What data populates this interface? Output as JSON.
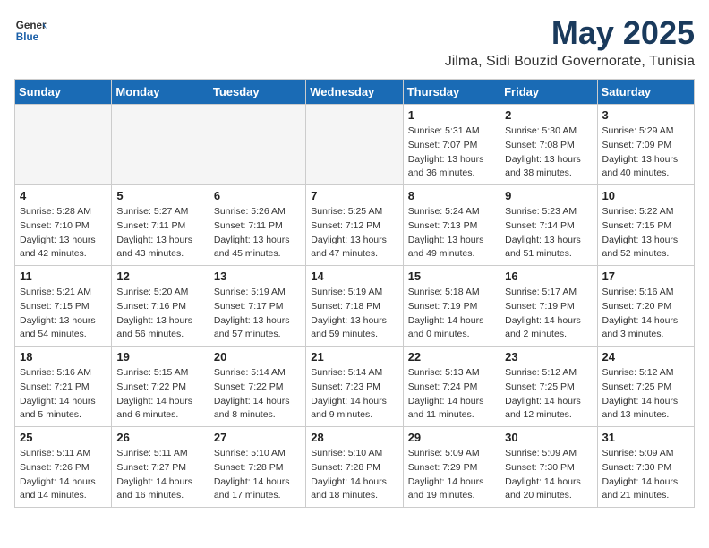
{
  "header": {
    "logo_general": "General",
    "logo_blue": "Blue",
    "month_year": "May 2025",
    "location": "Jilma, Sidi Bouzid Governorate, Tunisia"
  },
  "days_of_week": [
    "Sunday",
    "Monday",
    "Tuesday",
    "Wednesday",
    "Thursday",
    "Friday",
    "Saturday"
  ],
  "weeks": [
    [
      {
        "day": "",
        "info": ""
      },
      {
        "day": "",
        "info": ""
      },
      {
        "day": "",
        "info": ""
      },
      {
        "day": "",
        "info": ""
      },
      {
        "day": "1",
        "info": "Sunrise: 5:31 AM\nSunset: 7:07 PM\nDaylight: 13 hours\nand 36 minutes."
      },
      {
        "day": "2",
        "info": "Sunrise: 5:30 AM\nSunset: 7:08 PM\nDaylight: 13 hours\nand 38 minutes."
      },
      {
        "day": "3",
        "info": "Sunrise: 5:29 AM\nSunset: 7:09 PM\nDaylight: 13 hours\nand 40 minutes."
      }
    ],
    [
      {
        "day": "4",
        "info": "Sunrise: 5:28 AM\nSunset: 7:10 PM\nDaylight: 13 hours\nand 42 minutes."
      },
      {
        "day": "5",
        "info": "Sunrise: 5:27 AM\nSunset: 7:11 PM\nDaylight: 13 hours\nand 43 minutes."
      },
      {
        "day": "6",
        "info": "Sunrise: 5:26 AM\nSunset: 7:11 PM\nDaylight: 13 hours\nand 45 minutes."
      },
      {
        "day": "7",
        "info": "Sunrise: 5:25 AM\nSunset: 7:12 PM\nDaylight: 13 hours\nand 47 minutes."
      },
      {
        "day": "8",
        "info": "Sunrise: 5:24 AM\nSunset: 7:13 PM\nDaylight: 13 hours\nand 49 minutes."
      },
      {
        "day": "9",
        "info": "Sunrise: 5:23 AM\nSunset: 7:14 PM\nDaylight: 13 hours\nand 51 minutes."
      },
      {
        "day": "10",
        "info": "Sunrise: 5:22 AM\nSunset: 7:15 PM\nDaylight: 13 hours\nand 52 minutes."
      }
    ],
    [
      {
        "day": "11",
        "info": "Sunrise: 5:21 AM\nSunset: 7:15 PM\nDaylight: 13 hours\nand 54 minutes."
      },
      {
        "day": "12",
        "info": "Sunrise: 5:20 AM\nSunset: 7:16 PM\nDaylight: 13 hours\nand 56 minutes."
      },
      {
        "day": "13",
        "info": "Sunrise: 5:19 AM\nSunset: 7:17 PM\nDaylight: 13 hours\nand 57 minutes."
      },
      {
        "day": "14",
        "info": "Sunrise: 5:19 AM\nSunset: 7:18 PM\nDaylight: 13 hours\nand 59 minutes."
      },
      {
        "day": "15",
        "info": "Sunrise: 5:18 AM\nSunset: 7:19 PM\nDaylight: 14 hours\nand 0 minutes."
      },
      {
        "day": "16",
        "info": "Sunrise: 5:17 AM\nSunset: 7:19 PM\nDaylight: 14 hours\nand 2 minutes."
      },
      {
        "day": "17",
        "info": "Sunrise: 5:16 AM\nSunset: 7:20 PM\nDaylight: 14 hours\nand 3 minutes."
      }
    ],
    [
      {
        "day": "18",
        "info": "Sunrise: 5:16 AM\nSunset: 7:21 PM\nDaylight: 14 hours\nand 5 minutes."
      },
      {
        "day": "19",
        "info": "Sunrise: 5:15 AM\nSunset: 7:22 PM\nDaylight: 14 hours\nand 6 minutes."
      },
      {
        "day": "20",
        "info": "Sunrise: 5:14 AM\nSunset: 7:22 PM\nDaylight: 14 hours\nand 8 minutes."
      },
      {
        "day": "21",
        "info": "Sunrise: 5:14 AM\nSunset: 7:23 PM\nDaylight: 14 hours\nand 9 minutes."
      },
      {
        "day": "22",
        "info": "Sunrise: 5:13 AM\nSunset: 7:24 PM\nDaylight: 14 hours\nand 11 minutes."
      },
      {
        "day": "23",
        "info": "Sunrise: 5:12 AM\nSunset: 7:25 PM\nDaylight: 14 hours\nand 12 minutes."
      },
      {
        "day": "24",
        "info": "Sunrise: 5:12 AM\nSunset: 7:25 PM\nDaylight: 14 hours\nand 13 minutes."
      }
    ],
    [
      {
        "day": "25",
        "info": "Sunrise: 5:11 AM\nSunset: 7:26 PM\nDaylight: 14 hours\nand 14 minutes."
      },
      {
        "day": "26",
        "info": "Sunrise: 5:11 AM\nSunset: 7:27 PM\nDaylight: 14 hours\nand 16 minutes."
      },
      {
        "day": "27",
        "info": "Sunrise: 5:10 AM\nSunset: 7:28 PM\nDaylight: 14 hours\nand 17 minutes."
      },
      {
        "day": "28",
        "info": "Sunrise: 5:10 AM\nSunset: 7:28 PM\nDaylight: 14 hours\nand 18 minutes."
      },
      {
        "day": "29",
        "info": "Sunrise: 5:09 AM\nSunset: 7:29 PM\nDaylight: 14 hours\nand 19 minutes."
      },
      {
        "day": "30",
        "info": "Sunrise: 5:09 AM\nSunset: 7:30 PM\nDaylight: 14 hours\nand 20 minutes."
      },
      {
        "day": "31",
        "info": "Sunrise: 5:09 AM\nSunset: 7:30 PM\nDaylight: 14 hours\nand 21 minutes."
      }
    ]
  ]
}
